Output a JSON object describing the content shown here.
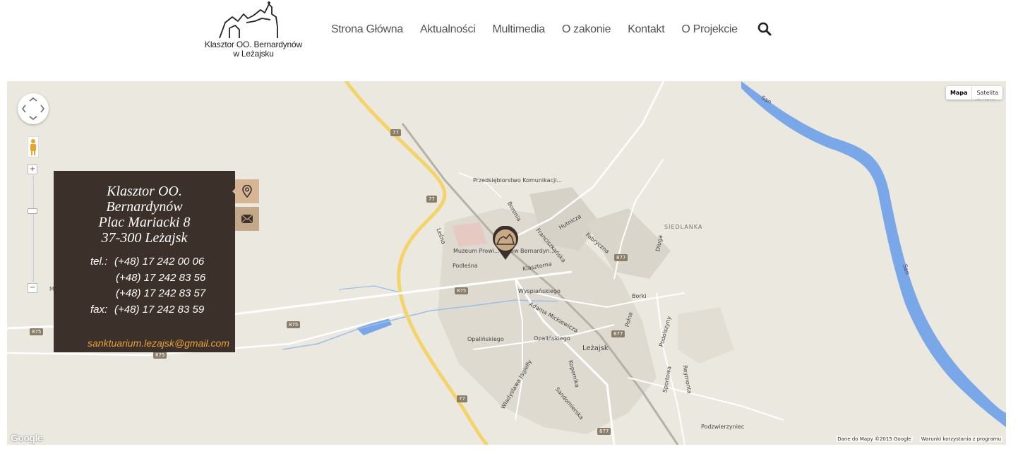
{
  "header": {
    "logo_line1": "Klasztor OO. Bernardynów",
    "logo_line2": "w Leżajsku",
    "nav": [
      "Strona Główna",
      "Aktualności",
      "Multimedia",
      "O zakonie",
      "Kontakt",
      "O Projekcie"
    ],
    "search_icon": "search-icon"
  },
  "map": {
    "type_controls": {
      "map": "Mapa",
      "satellite": "Satelita"
    },
    "zoom_in": "+",
    "zoom_out": "−",
    "labels": {
      "przedsiebiorstwo": "Przedsiębiorstwo Komunikacji...",
      "muzeum": "Muzeum Prowi... Ojców Bernardyn...",
      "podlesna": "Podleśna",
      "lesna": "Leśna",
      "boronia": "Boronia",
      "hutnicza": "Hutnicza",
      "fabryczna": "Fabryczna",
      "franciszkanska": "Franciszkańska",
      "klasztorna": "Klasztorna",
      "wyspianskiego": "Wyspiańskiego",
      "mickiewicza": "Adama Mickiewicza",
      "opalinskiego1": "Opalińskiego",
      "opalinskiego2": "Opalińskiego",
      "lezajsk": "Leżajsk",
      "siedlanka": "SIEDLANKA",
      "dluga": "Długa",
      "polna": "Polna",
      "borki": "Borki",
      "podolszyny": "Podolszyny",
      "sportowa": "Sportowa",
      "reymonta": "Reymonta",
      "kopernika": "Kopernika",
      "sandomierska": "Sandomierska",
      "jagielly": "Władysława Jagiełły",
      "podzwierzyniec": "Podzwierzyniec",
      "san1": "San",
      "san2": "San",
      "tarnawi": "Tarnawi",
      "m": "M"
    },
    "shields": {
      "r77a": "77",
      "r77b": "77",
      "r77c": "77",
      "r875a": "875",
      "r875b": "875",
      "r875c": "875",
      "r875d": "875",
      "r877a": "877",
      "r877b": "877",
      "r877c": "877"
    },
    "google_logo": "Google",
    "credits_data": "Dane do Mapy ©2015 Google",
    "credits_terms": "Warunki korzystania z programu"
  },
  "info_card": {
    "name_line1": "Klasztor OO.",
    "name_line2": "Bernardynów",
    "street": "Plac Mariacki 8",
    "city": "37-300 Leżajsk",
    "tel_label": "tel.:",
    "fax_label": "fax:",
    "phone1": "(+48) 17 242 00 06",
    "phone2": "(+48) 17 242 83 56",
    "phone3": "(+48) 17 242 83 57",
    "fax": "(+48) 17 242 83 59",
    "email": "sanktuarium.lezajsk@gmail.com"
  },
  "colors": {
    "card_bg": "#3c302a",
    "tab_bg": "#c4a88a",
    "email": "#e7a13c",
    "river": "#7aa7e8",
    "highway": "#f3d36a"
  }
}
